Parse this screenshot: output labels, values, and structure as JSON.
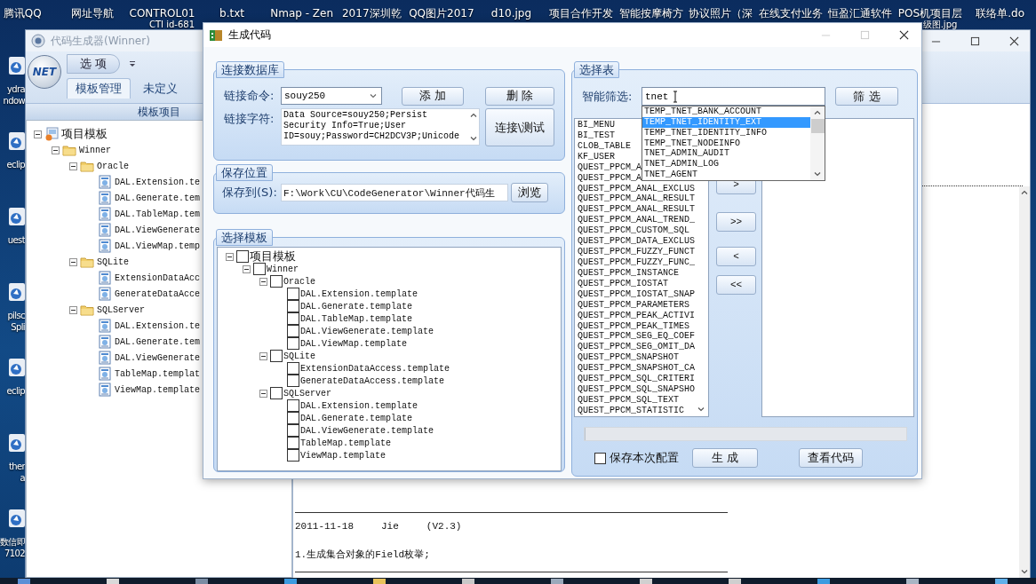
{
  "desktop": {
    "icons_top": [
      {
        "label": "腾讯QQ"
      },
      {
        "label": "网址导航"
      },
      {
        "label": "CONTROL01",
        "label_2": "CTI id-681"
      },
      {
        "label": "b.txt"
      },
      {
        "label": "Nmap - Zen"
      },
      {
        "label": "2017深圳乾"
      },
      {
        "label": "QQ图片2017"
      },
      {
        "label": "d10.jpg"
      },
      {
        "label": "项目合作开发"
      },
      {
        "label": "智能按摩椅方"
      },
      {
        "label": "协议照片（深"
      },
      {
        "label": "在线支付业务"
      },
      {
        "label": "恒盈汇通软件"
      },
      {
        "label": "POS机项目层",
        "label_2": "级图.jpg"
      },
      {
        "label": "联络单.do"
      }
    ],
    "icons_left": [
      {
        "lines": [
          "ydra",
          "ndow"
        ]
      },
      {
        "lines": [
          "eclip"
        ]
      },
      {
        "lines": [
          "uest"
        ]
      },
      {
        "lines": [
          "pilsc",
          "Spli"
        ]
      },
      {
        "lines": [
          "eclip"
        ]
      },
      {
        "lines": [
          "ther",
          "a"
        ]
      },
      {
        "lines": [
          "数信即",
          "7102"
        ]
      }
    ]
  },
  "main_window": {
    "title": "代码生成器(Winner)",
    "logo_text": "NET",
    "menu_button": "选 项",
    "tabs": [
      {
        "label": "模板管理",
        "selected": true
      },
      {
        "label": "未定义",
        "selected": false
      }
    ],
    "panel_title": "模板项目",
    "tree": [
      {
        "label": "项目模板",
        "kind": "project",
        "expanded": true,
        "children": [
          {
            "label": "Winner",
            "kind": "folder",
            "expanded": true,
            "children": [
              {
                "label": "Oracle",
                "kind": "folder",
                "expanded": true,
                "children": [
                  {
                    "label": "DAL.Extension.te",
                    "kind": "file"
                  },
                  {
                    "label": "DAL.Generate.tem",
                    "kind": "file"
                  },
                  {
                    "label": "DAL.TableMap.tem",
                    "kind": "file"
                  },
                  {
                    "label": "DAL.ViewGenerate",
                    "kind": "file"
                  },
                  {
                    "label": "DAL.ViewMap.temp",
                    "kind": "file"
                  }
                ]
              },
              {
                "label": "SQLite",
                "kind": "folder",
                "expanded": true,
                "children": [
                  {
                    "label": "ExtensionDataAcc",
                    "kind": "file"
                  },
                  {
                    "label": "GenerateDataAcce",
                    "kind": "file"
                  }
                ]
              },
              {
                "label": "SQLServer",
                "kind": "folder",
                "expanded": true,
                "children": [
                  {
                    "label": "DAL.Extension.te",
                    "kind": "file"
                  },
                  {
                    "label": "DAL.Generate.tem",
                    "kind": "file"
                  },
                  {
                    "label": "DAL.ViewGenerate",
                    "kind": "file"
                  },
                  {
                    "label": "TableMap.templat",
                    "kind": "file"
                  },
                  {
                    "label": "ViewMap.template",
                    "kind": "file"
                  }
                ]
              }
            ]
          }
        ]
      }
    ],
    "notes": {
      "date": "2011-11-18",
      "author": "Jie",
      "version": "(V2.3)",
      "item": "1.生成集合对象的Field枚举;"
    }
  },
  "dialog": {
    "title": "生成代码",
    "connection": {
      "legend": "连接数据库",
      "command_label": "链接命令:",
      "command_value": "souy250",
      "add_button": "添 加",
      "delete_button": "删 除",
      "string_label": "链接字符:",
      "string_lines": [
        "Data Source=souy250;Persist",
        "Security Info=True;User",
        "ID=souy;Password=CH2DCV3P;Unicode"
      ],
      "test_button": "连接\\测试"
    },
    "save": {
      "legend": "保存位置",
      "label": "保存到(S):",
      "path": "F:\\Work\\CU\\CodeGenerator\\Winner代码生",
      "browse_button": "浏览"
    },
    "templates": {
      "legend": "选择模板",
      "tree": [
        {
          "label": "项目模板",
          "checked": false,
          "expanded": true,
          "children": [
            {
              "label": "Winner",
              "checked": false,
              "expanded": true,
              "children": [
                {
                  "label": "Oracle",
                  "checked": false,
                  "expanded": true,
                  "children": [
                    {
                      "label": "DAL.Extension.template",
                      "checked": false
                    },
                    {
                      "label": "DAL.Generate.template",
                      "checked": false
                    },
                    {
                      "label": "DAL.TableMap.template",
                      "checked": false
                    },
                    {
                      "label": "DAL.ViewGenerate.template",
                      "checked": false
                    },
                    {
                      "label": "DAL.ViewMap.template",
                      "checked": false
                    }
                  ]
                },
                {
                  "label": "SQLite",
                  "checked": false,
                  "expanded": true,
                  "children": [
                    {
                      "label": "ExtensionDataAccess.template",
                      "checked": false
                    },
                    {
                      "label": "GenerateDataAccess.template",
                      "checked": false
                    }
                  ]
                },
                {
                  "label": "SQLServer",
                  "checked": false,
                  "expanded": true,
                  "children": [
                    {
                      "label": "DAL.Extension.template",
                      "checked": false
                    },
                    {
                      "label": "DAL.Generate.template",
                      "checked": false
                    },
                    {
                      "label": "DAL.ViewGenerate.template",
                      "checked": false
                    },
                    {
                      "label": "TableMap.template",
                      "checked": false
                    },
                    {
                      "label": "ViewMap.template",
                      "checked": false
                    }
                  ]
                }
              ]
            }
          ]
        }
      ]
    },
    "tables": {
      "legend": "选择表",
      "filter_label": "智能筛选:",
      "filter_value": "tnet",
      "filter_button": "筛 选",
      "suggestions": [
        {
          "label": "TEMP_TNET_BANK_ACCOUNT",
          "selected": false
        },
        {
          "label": "TEMP_TNET_IDENTITY_EXT",
          "selected": true
        },
        {
          "label": "TEMP_TNET_IDENTITY_INFO",
          "selected": false
        },
        {
          "label": "TEMP_TNET_NODEINFO",
          "selected": false
        },
        {
          "label": "TNET_ADMIN_AUDIT",
          "selected": false
        },
        {
          "label": "TNET_ADMIN_LOG",
          "selected": false
        },
        {
          "label": "TNET_AGENT",
          "selected": false
        }
      ],
      "available": [
        "BI_MENU",
        "BI_TEST",
        "CLOB_TABLE",
        "KF_USER",
        "QUEST_PPCM_A",
        "QUEST_PPCM_A",
        "QUEST_PPCM_ANAL_EXCLUS",
        "QUEST_PPCM_ANAL_RESULT",
        "QUEST_PPCM_ANAL_RESULT",
        "QUEST_PPCM_ANAL_TREND_",
        "QUEST_PPCM_CUSTOM_SQL",
        "QUEST_PPCM_DATA_EXCLUS",
        "QUEST_PPCM_FUZZY_FUNCT",
        "QUEST_PPCM_FUZZY_FUNC_",
        "QUEST_PPCM_INSTANCE",
        "QUEST_PPCM_IOSTAT",
        "QUEST_PPCM_IOSTAT_SNAP",
        "QUEST_PPCM_PARAMETERS",
        "QUEST_PPCM_PEAK_ACTIVI",
        "QUEST_PPCM_PEAK_TIMES",
        "QUEST_PPCM_SEG_EQ_COEF",
        "QUEST_PPCM_SEG_OMIT_DA",
        "QUEST_PPCM_SNAPSHOT",
        "QUEST_PPCM_SNAPSHOT_CA",
        "QUEST_PPCM_SQL_CRITERI",
        "QUEST_PPCM_SQL_SNAPSHO",
        "QUEST_PPCM_SQL_TEXT",
        "QUEST_PPCM_STATISTIC"
      ],
      "move_buttons": [
        ">",
        ">>",
        "<",
        "<<"
      ],
      "progress": {
        "level": 0
      },
      "save_config": {
        "label": "保存本次配置",
        "checked": false
      },
      "generate_button": "生 成",
      "view_button": "查看代码"
    }
  }
}
